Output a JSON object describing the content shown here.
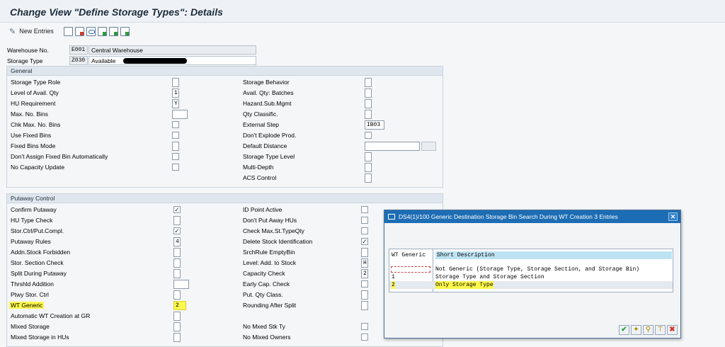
{
  "title": "Change View \"Define Storage Types\": Details",
  "toolbar": {
    "new_entries": "New Entries"
  },
  "header": {
    "warehouse_label": "Warehouse No.",
    "warehouse_key": "E001",
    "warehouse_desc": "Central Warehouse",
    "storage_type_label": "Storage Type",
    "storage_type_key": "Z030",
    "storage_type_desc": "Available"
  },
  "general": {
    "title": "General",
    "left": [
      {
        "label": "Storage Type Role",
        "kind": "tf",
        "value": ""
      },
      {
        "label": "Level of Avail. Qty",
        "kind": "tf",
        "value": "1"
      },
      {
        "label": "HU Requirement",
        "kind": "tf",
        "value": "Y"
      },
      {
        "label": "Max. No. Bins",
        "kind": "tfwide",
        "value": ""
      },
      {
        "label": "Chk Max. No. Bins",
        "kind": "cb",
        "value": ""
      },
      {
        "label": "Use Fixed Bins",
        "kind": "cb",
        "value": ""
      },
      {
        "label": "Fixed Bins Mode",
        "kind": "tf",
        "value": ""
      },
      {
        "label": "Don't Assign Fixed Bin Automatically",
        "kind": "cb",
        "value": ""
      },
      {
        "label": "No Capacity Update",
        "kind": "cb",
        "value": ""
      }
    ],
    "right": [
      {
        "label": "Storage Behavior",
        "kind": "tf",
        "value": ""
      },
      {
        "label": "Avail. Qty: Batches",
        "kind": "tf",
        "value": ""
      },
      {
        "label": "Hazard.Sub.Mgmt",
        "kind": "tf",
        "value": ""
      },
      {
        "label": "Qty Classific.",
        "kind": "tf",
        "value": ""
      },
      {
        "label": "External Step",
        "kind": "tfmid",
        "value": "IB03"
      },
      {
        "label": "Don't Explode Prod.",
        "kind": "cb",
        "value": ""
      },
      {
        "label": "Default Distance",
        "kind": "tfdist",
        "value": ""
      },
      {
        "label": "Storage Type Level",
        "kind": "tf",
        "value": ""
      },
      {
        "label": "Multi-Depth",
        "kind": "tf",
        "value": ""
      },
      {
        "label": "ACS Control",
        "kind": "tf",
        "value": ""
      }
    ]
  },
  "putaway": {
    "title": "Putaway Control",
    "left": [
      {
        "label": "Confirm Putaway",
        "kind": "cb",
        "value": "✓"
      },
      {
        "label": "HU Type Check",
        "kind": "tf",
        "value": ""
      },
      {
        "label": "Stor.Ctrl/Put.Compl.",
        "kind": "cb",
        "value": "✓"
      },
      {
        "label": "Putaway Rules",
        "kind": "tf",
        "value": "4"
      },
      {
        "label": "Addn.Stock Forbidden",
        "kind": "tf",
        "value": ""
      },
      {
        "label": "Stor. Section Check",
        "kind": "tf",
        "value": ""
      },
      {
        "label": "Split During Putaway",
        "kind": "tf",
        "value": ""
      },
      {
        "label": "Thrshld Addition",
        "kind": "tfwide",
        "value": ""
      },
      {
        "label": "Ptwy Stor. Ctrl",
        "kind": "tf",
        "value": ""
      },
      {
        "label": "WT Generic",
        "kind": "tfhl",
        "value": "2"
      },
      {
        "label": "Automatic WT Creation at GR",
        "kind": "tf",
        "value": ""
      },
      {
        "label": "Mixed Storage",
        "kind": "tf",
        "value": ""
      },
      {
        "label": "Mixed Storage in HUs",
        "kind": "tf",
        "value": ""
      }
    ],
    "right": [
      {
        "label": "ID Point Active",
        "kind": "cb",
        "value": ""
      },
      {
        "label": "Don't Put Away HUs",
        "kind": "cb",
        "value": ""
      },
      {
        "label": "Check Max.St.TypeQty",
        "kind": "cb",
        "value": ""
      },
      {
        "label": "Delete Stock Identification",
        "kind": "cb",
        "value": "✓"
      },
      {
        "label": "SrchRule EmptyBin",
        "kind": "tf",
        "value": ""
      },
      {
        "label": "Level: Add. to Stock",
        "kind": "tf",
        "value": "H"
      },
      {
        "label": "Capacity Check",
        "kind": "tf",
        "value": "2"
      },
      {
        "label": "Early Cap. Check",
        "kind": "cb",
        "value": ""
      },
      {
        "label": "Put. Qty Class.",
        "kind": "tf",
        "value": ""
      },
      {
        "label": "Rounding After Split",
        "kind": "tf",
        "value": ""
      },
      {
        "label": "",
        "kind": "none",
        "value": ""
      },
      {
        "label": "No Mxed Stk Ty",
        "kind": "cb",
        "value": ""
      },
      {
        "label": "No Mixed Owners",
        "kind": "cb",
        "value": ""
      }
    ]
  },
  "popup": {
    "title": "DS4(1)/100 Generic Destination Storage Bin Search During WT Creation   3 Entries",
    "col1": "WT Generic",
    "col2": "Short Description",
    "rows": [
      {
        "key": "",
        "desc": "Not Generic (Storage Type, Storage Section, and Storage Bin)"
      },
      {
        "key": "1",
        "desc": "Storage Type and Storage Section"
      },
      {
        "key": "2",
        "desc": "Only Storage Type"
      }
    ],
    "close": "✕",
    "btn_ok": "✔",
    "btn_cancel": "✖"
  }
}
